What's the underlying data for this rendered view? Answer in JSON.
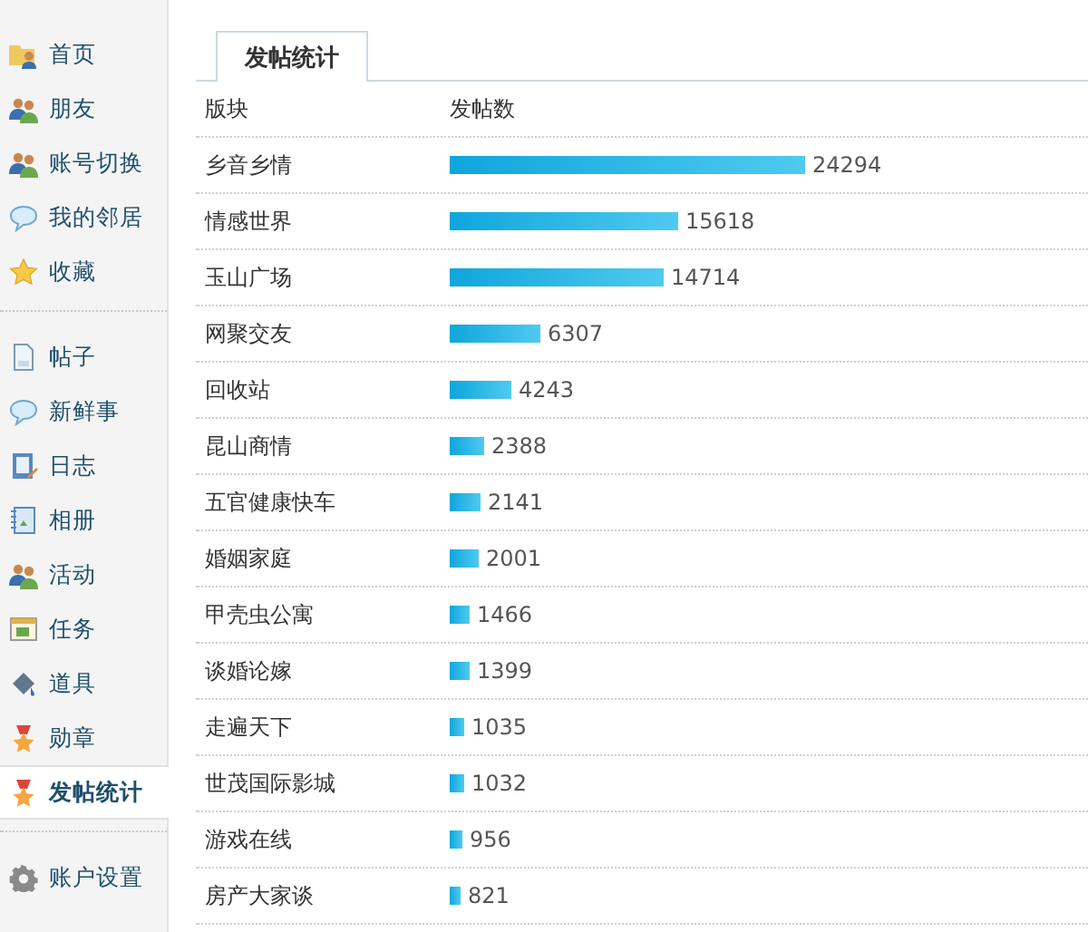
{
  "sidebar": {
    "sections": [
      [
        {
          "label": "首页",
          "selected": false
        },
        {
          "label": "朋友",
          "selected": false
        },
        {
          "label": "账号切换",
          "selected": false
        },
        {
          "label": "我的邻居",
          "selected": false
        },
        {
          "label": "收藏",
          "selected": false
        }
      ],
      [
        {
          "label": "帖子",
          "selected": false
        },
        {
          "label": "新鲜事",
          "selected": false
        },
        {
          "label": "日志",
          "selected": false
        },
        {
          "label": "相册",
          "selected": false
        },
        {
          "label": "活动",
          "selected": false
        },
        {
          "label": "任务",
          "selected": false
        },
        {
          "label": "道具",
          "selected": false
        },
        {
          "label": "勋章",
          "selected": false
        },
        {
          "label": "发帖统计",
          "selected": true
        }
      ],
      [
        {
          "label": "账户设置",
          "selected": false
        }
      ]
    ]
  },
  "tabs": [
    {
      "label": "发帖统计",
      "selected": true
    }
  ],
  "table": {
    "columns": [
      "版块",
      "发帖数"
    ],
    "rows": [
      {
        "board": "乡音乡情",
        "count": "24294"
      },
      {
        "board": "情感世界",
        "count": "15618"
      },
      {
        "board": "玉山广场",
        "count": "14714"
      },
      {
        "board": "网聚交友",
        "count": "6307"
      },
      {
        "board": "回收站",
        "count": "4243"
      },
      {
        "board": "昆山商情",
        "count": "2388"
      },
      {
        "board": "五官健康快车",
        "count": "2141"
      },
      {
        "board": "婚姻家庭",
        "count": "2001"
      },
      {
        "board": "甲壳虫公寓",
        "count": "1466"
      },
      {
        "board": "谈婚论嫁",
        "count": "1399"
      },
      {
        "board": "走遍天下",
        "count": "1035"
      },
      {
        "board": "世茂国际影城",
        "count": "1032"
      },
      {
        "board": "游戏在线",
        "count": "956"
      },
      {
        "board": "房产大家谈",
        "count": "821"
      }
    ]
  }
}
